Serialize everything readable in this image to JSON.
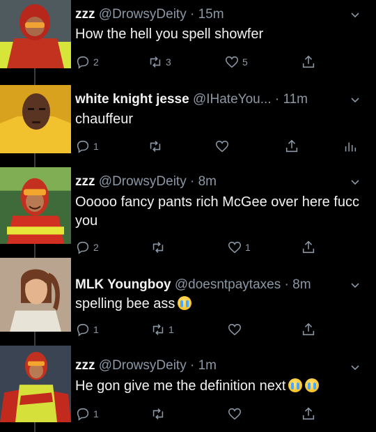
{
  "tweets": [
    {
      "name": "zzz",
      "handle": "@DrowsyDeity",
      "dot": "·",
      "time": "15m",
      "text": "How the hell you spell showfer",
      "replies": "2",
      "retweets": "3",
      "likes": "5",
      "emojis": 0,
      "has_analytics": false,
      "avatar": "hooded-hero-red-yellow"
    },
    {
      "name": "white knight jesse",
      "handle": "@IHateYou...",
      "dot": "·",
      "time": "11m",
      "text": "chauffeur",
      "replies": "1",
      "retweets": "",
      "likes": "",
      "emojis": 0,
      "has_analytics": true,
      "avatar": "bald-man-yellow-suit"
    },
    {
      "name": "zzz",
      "handle": "@DrowsyDeity",
      "dot": "·",
      "time": "8m",
      "text": "Ooooo fancy pants rich McGee over here fucc you",
      "replies": "2",
      "retweets": "",
      "likes": "1",
      "emojis": 0,
      "has_analytics": false,
      "avatar": "goggles-hero-smiling"
    },
    {
      "name": "MLK Youngboy",
      "handle": "@doesntpaytaxes",
      "dot": "·",
      "time": "8m",
      "text": "spelling bee ass",
      "replies": "1",
      "retweets": "1",
      "likes": "",
      "emojis": 1,
      "has_analytics": false,
      "avatar": "girl-ponytail"
    },
    {
      "name": "zzz",
      "handle": "@DrowsyDeity",
      "dot": "·",
      "time": "1m",
      "text": "He gon give me the definition next",
      "replies": "1",
      "retweets": "",
      "likes": "",
      "emojis": 2,
      "has_analytics": false,
      "avatar": "hero-crowd"
    }
  ],
  "colors": {
    "background": "#000000",
    "text": "#f2f2f2",
    "muted": "#8b98a5",
    "thread_line": "#3a3d40"
  },
  "icons": {
    "reply": "reply-icon",
    "retweet": "retweet-icon",
    "like": "heart-icon",
    "share": "share-icon",
    "analytics": "analytics-icon",
    "more": "chevron-down-icon",
    "emoji": "loudly-crying-face-emoji"
  }
}
